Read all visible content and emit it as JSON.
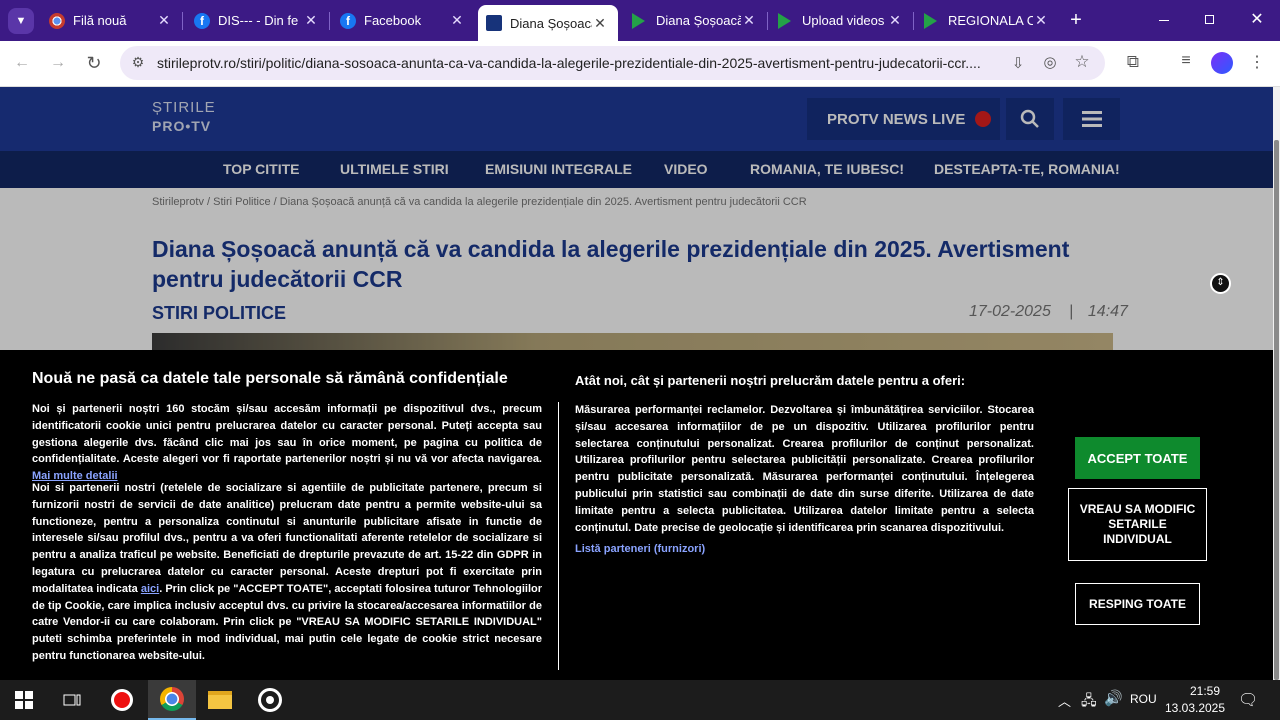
{
  "browser": {
    "tabs": [
      {
        "title": "Filă nouă",
        "favicon": "chrome-icon",
        "active": false
      },
      {
        "title": "DIS--- - Din fe",
        "favicon": "facebook-icon",
        "active": false
      },
      {
        "title": "Facebook",
        "favicon": "facebook-icon",
        "active": false
      },
      {
        "title": "Diana Șoșoacă",
        "favicon": "protv-icon",
        "active": true
      },
      {
        "title": "Diana Șoșoacă",
        "favicon": "media-icon",
        "active": false
      },
      {
        "title": "Upload videos",
        "favicon": "media-icon",
        "active": false
      },
      {
        "title": "REGIONALA C",
        "favicon": "media-icon",
        "active": false
      }
    ],
    "new_tab_glyph": "+",
    "url": "stirileprotv.ro/stiri/politic/diana-sosoaca-anunta-ca-va-candida-la-alegerile-prezidentiale-din-2025-avertisment-pentru-judecatorii-ccr...."
  },
  "site": {
    "logo_line1": "ȘTIRILE",
    "logo_line2": "PRO•TV",
    "live_label": "PROTV NEWS LIVE",
    "nav": [
      "TOP CITITE",
      "ULTIMELE STIRI",
      "EMISIUNI INTEGRALE",
      "VIDEO",
      "ROMANIA, TE IUBESC!",
      "DESTEAPTA-TE, ROMANIA!"
    ]
  },
  "article": {
    "breadcrumb": "Stirileprotv / Stiri Politice / Diana Șoșoacă anunță că va candida la alegerile prezidențiale din 2025. Avertisment pentru judecătorii CCR",
    "headline": "Diana Șoșoacă anunță că va candida la alegerile prezidențiale din 2025. Avertisment pentru judecătorii CCR",
    "category": "STIRI POLITICE",
    "date": "17-02-2025",
    "date_sep": "|",
    "time": "14:47"
  },
  "consent": {
    "title": "Nouă ne pasă ca datele tale personale să rămână confidențiale",
    "para1_a": "Noi și partenerii noștri ",
    "para1_count": "160",
    "para1_b": " stocăm și/sau accesăm informații pe dispozitivul dvs., precum identificatorii cookie unici pentru prelucrarea datelor cu caracter personal. Puteți accepta sau gestiona alegerile dvs. făcând clic mai jos sau în orice moment, pe pagina cu politica de confidențialitate. Aceste alegeri vor fi raportate partenerilor noștri și nu vă vor afecta navigarea. ",
    "para1_link": "Mai multe detalii",
    "para2_a": "Noi si partenerii nostri (retelele de socializare si agentiile de publicitate partenere, precum si furnizorii nostri de servicii de date analitice) prelucram date pentru a permite website-ului sa functioneze, pentru a personaliza continutul si anunturile publicitare afisate in functie de interesele si/sau profilul dvs., pentru a va oferi functionalitati aferente retelelor de socializare si pentru a analiza traficul pe website. Beneficiati de drepturile prevazute de art. 15-22 din GDPR in legatura cu prelucrarea datelor cu caracter personal. Aceste drepturi pot fi exercitate prin modalitatea indicata ",
    "para2_link": "aici",
    "para2_b": ". Prin click pe \"ACCEPT TOATE\", acceptati folosirea tuturor Tehnologiilor de tip Cookie, care implica inclusiv acceptul dvs. cu privire la stocarea/accesarea informatiilor de catre Vendor-ii cu care colaboram. Prin click pe \"VREAU SA MODIFIC SETARILE INDIVIDUAL\" puteti schimba preferintele in mod individual, mai putin cele legate de cookie strict necesare pentru functionarea website-ului.",
    "right_title": "Atât noi, cât și partenerii noștri prelucrăm datele pentru a oferi:",
    "right_text": "Măsurarea performanței reclamelor. Dezvoltarea și îmbunătățirea serviciilor. Stocarea și/sau accesarea informațiilor de pe un dispozitiv. Utilizarea profilurilor pentru selectarea conținutului personalizat. Crearea profilurilor de conținut personalizat. Utilizarea profilurilor pentru selectarea publicității personalizate. Crearea profilurilor pentru publicitate personalizată. Măsurarea performanței conținutului. Înțelegerea publicului prin statistici sau combinații de date din surse diferite. Utilizarea de date limitate pentru a selecta publicitatea. Utilizarea datelor limitate pentru a selecta conținutul. Date precise de geolocație și identificarea prin scanarea dispozitivului.",
    "partners_link": "Listă parteneri (furnizori)",
    "accept_label": "ACCEPT TOATE",
    "modify_label": "VREAU SA MODIFIC SETARILE INDIVIDUAL",
    "reject_label": "RESPING TOATE"
  },
  "taskbar": {
    "lang": "ROU",
    "time": "21:59",
    "date": "13.03.2025"
  },
  "colors": {
    "tabstrip": "#3c1a85",
    "site_header": "#1f3a98",
    "headline": "#1c3a8f",
    "accept": "#0e8a2d"
  }
}
